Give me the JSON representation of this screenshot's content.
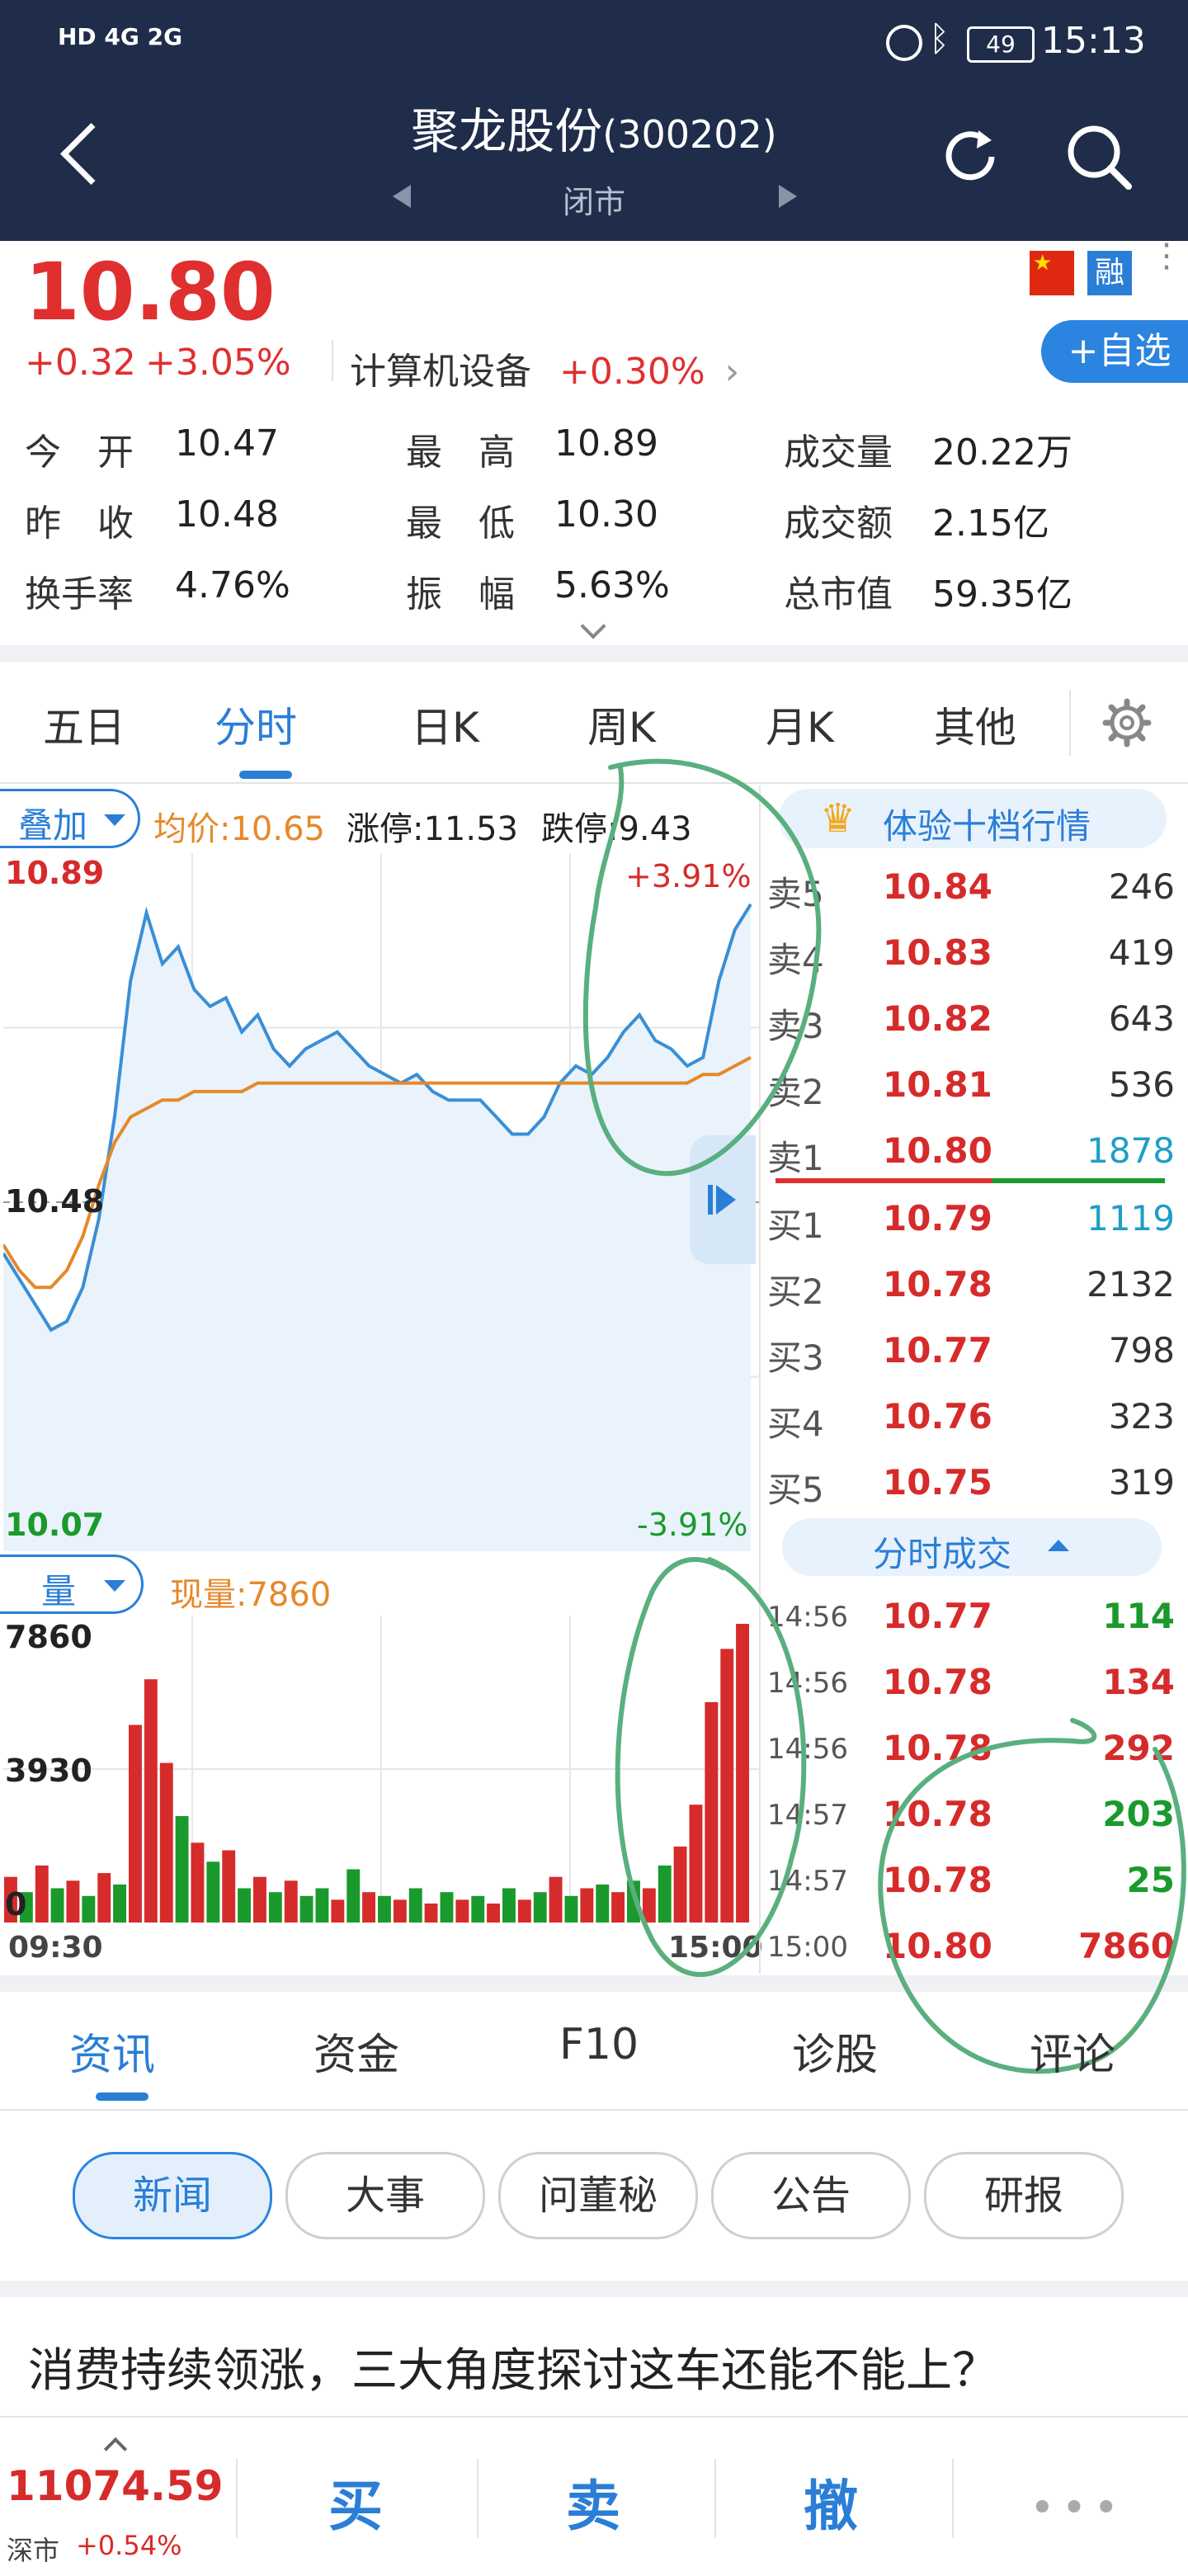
{
  "status_bar": {
    "left_icons": "HD 4G 2G",
    "battery": "49",
    "time": "15:13"
  },
  "nav": {
    "title": "聚龙股份",
    "code": "(300202)",
    "market_status": "闭市"
  },
  "quote": {
    "price": "10.80",
    "change": "+0.32",
    "change_pct": "+3.05%",
    "sector": "计算机设备",
    "sector_change": "+0.30%",
    "badge_rong": "融",
    "add_watch": "+自选",
    "stats": [
      {
        "label": "今　开",
        "value": "10.47"
      },
      {
        "label": "最　高",
        "value": "10.89"
      },
      {
        "label": "成交量",
        "value": "20.22万"
      },
      {
        "label": "昨　收",
        "value": "10.48"
      },
      {
        "label": "最　低",
        "value": "10.30"
      },
      {
        "label": "成交额",
        "value": "2.15亿"
      },
      {
        "label": "换手率",
        "value": "4.76%"
      },
      {
        "label": "振　幅",
        "value": "5.63%"
      },
      {
        "label": "总市值",
        "value": "59.35亿"
      }
    ]
  },
  "chart_tabs": [
    "五日",
    "分时",
    "日K",
    "周K",
    "月K",
    "其他"
  ],
  "chart_toolbar": {
    "overlay": "叠加",
    "avg_label": "均价:10.65",
    "limit_up": "涨停:11.53",
    "limit_down": "跌停:9.43",
    "level10": "体验十档行情"
  },
  "chart_data": [
    {
      "type": "line",
      "x_start": "09:30",
      "x_end": "15:00",
      "ylim": [
        10.07,
        10.89
      ],
      "y_max_label": "10.89",
      "y_mid_label": "10.48",
      "y_min_label": "10.07",
      "pct_top": "+3.91%",
      "pct_bottom": "-3.91%",
      "series": [
        {
          "values": [
            10.42,
            10.39,
            10.36,
            10.33,
            10.34,
            10.38,
            10.46,
            10.58,
            10.74,
            10.82,
            10.76,
            10.78,
            10.73,
            10.71,
            10.72,
            10.68,
            10.7,
            10.66,
            10.64,
            10.66,
            10.67,
            10.68,
            10.66,
            10.64,
            10.63,
            10.62,
            10.63,
            10.61,
            10.6,
            10.6,
            10.6,
            10.58,
            10.56,
            10.56,
            10.58,
            10.62,
            10.64,
            10.63,
            10.65,
            10.68,
            10.7,
            10.67,
            10.66,
            10.64,
            10.65,
            10.74,
            10.8,
            10.83
          ]
        },
        {
          "values": [
            10.43,
            10.4,
            10.38,
            10.38,
            10.4,
            10.44,
            10.5,
            10.55,
            10.58,
            10.59,
            10.6,
            10.6,
            10.61,
            10.61,
            10.61,
            10.61,
            10.62,
            10.62,
            10.62,
            10.62,
            10.62,
            10.62,
            10.62,
            10.62,
            10.62,
            10.62,
            10.62,
            10.62,
            10.62,
            10.62,
            10.62,
            10.62,
            10.62,
            10.62,
            10.62,
            10.62,
            10.62,
            10.62,
            10.62,
            10.62,
            10.62,
            10.62,
            10.62,
            10.62,
            10.63,
            10.63,
            10.64,
            10.65
          ]
        }
      ]
    },
    {
      "type": "bar",
      "label": "量",
      "current_label": "现量:7860",
      "y_max_label": "7860",
      "y_mid_label": "3930",
      "y_min_label": "0",
      "ylim": [
        0,
        7860
      ],
      "values": [
        1200,
        800,
        1500,
        900,
        1100,
        700,
        1300,
        1000,
        5200,
        6400,
        4200,
        2800,
        2100,
        1600,
        1900,
        900,
        1200,
        800,
        1100,
        700,
        900,
        600,
        1400,
        800,
        700,
        600,
        900,
        500,
        800,
        600,
        700,
        500,
        900,
        600,
        800,
        1200,
        700,
        900,
        1000,
        800,
        1100,
        900,
        1500,
        2000,
        3100,
        5800,
        7200,
        7860
      ],
      "colors": [
        "r",
        "g",
        "r",
        "g",
        "r",
        "g",
        "r",
        "g",
        "r",
        "r",
        "r",
        "g",
        "r",
        "g",
        "r",
        "g",
        "r",
        "g",
        "r",
        "g",
        "g",
        "r",
        "g",
        "r",
        "g",
        "r",
        "g",
        "r",
        "g",
        "r",
        "g",
        "r",
        "g",
        "r",
        "g",
        "r",
        "g",
        "r",
        "g",
        "r",
        "g",
        "r",
        "g",
        "r",
        "r",
        "r",
        "r",
        "r"
      ]
    }
  ],
  "order_book": {
    "sell": [
      {
        "label": "卖5",
        "price": "10.84",
        "vol": "246"
      },
      {
        "label": "卖4",
        "price": "10.83",
        "vol": "419"
      },
      {
        "label": "卖3",
        "price": "10.82",
        "vol": "643"
      },
      {
        "label": "卖2",
        "price": "10.81",
        "vol": "536"
      },
      {
        "label": "卖1",
        "price": "10.80",
        "vol": "1878"
      }
    ],
    "buy": [
      {
        "label": "买1",
        "price": "10.79",
        "vol": "1119"
      },
      {
        "label": "买2",
        "price": "10.78",
        "vol": "2132"
      },
      {
        "label": "买3",
        "price": "10.77",
        "vol": "798"
      },
      {
        "label": "买4",
        "price": "10.76",
        "vol": "323"
      },
      {
        "label": "买5",
        "price": "10.75",
        "vol": "319"
      }
    ]
  },
  "trades": {
    "title": "分时成交",
    "rows": [
      {
        "time": "14:56",
        "price": "10.77",
        "vol": "114",
        "color": "#1a9a2c"
      },
      {
        "time": "14:56",
        "price": "10.78",
        "vol": "134",
        "color": "#d62b2b"
      },
      {
        "time": "14:56",
        "price": "10.78",
        "vol": "292",
        "color": "#d62b2b"
      },
      {
        "time": "14:57",
        "price": "10.78",
        "vol": "203",
        "color": "#1a9a2c"
      },
      {
        "time": "14:57",
        "price": "10.78",
        "vol": "25",
        "color": "#1a9a2c"
      },
      {
        "time": "15:00",
        "price": "10.80",
        "vol": "7860",
        "color": "#d62b2b"
      }
    ]
  },
  "info_tabs": [
    "资讯",
    "资金",
    "F10",
    "诊股",
    "评论"
  ],
  "info_pills": [
    "新闻",
    "大事",
    "问董秘",
    "公告",
    "研报"
  ],
  "news": {
    "headline": "消费持续领涨，三大角度探讨这车还能不能上？"
  },
  "bottom_bar": {
    "index_value": "11074.59",
    "index_name": "深市",
    "index_change": "+0.54%",
    "buy": "买",
    "sell": "卖",
    "cancel": "撤"
  },
  "colors": {
    "nav_bg": "#1f2d4a",
    "up": "#e02f2f",
    "down": "#1a9a2c",
    "accent": "#2a7ed6",
    "price_line": "#3a8fd6",
    "avg_line": "#e5892a",
    "annotation": "#5aaf7e"
  }
}
